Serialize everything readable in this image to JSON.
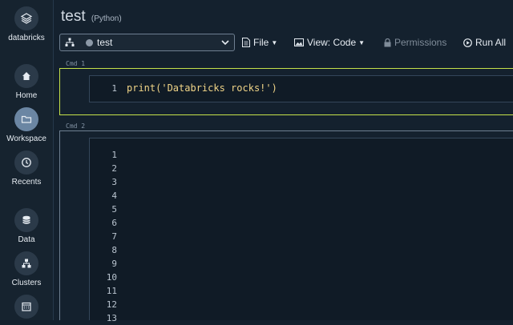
{
  "sidebar": {
    "logo_label": "databricks",
    "items": [
      {
        "label": "Home",
        "icon": "home-icon"
      },
      {
        "label": "Workspace",
        "icon": "folder-icon",
        "active": true
      },
      {
        "label": "Recents",
        "icon": "clock-icon"
      },
      {
        "label": "Data",
        "icon": "database-icon"
      },
      {
        "label": "Clusters",
        "icon": "cluster-icon"
      },
      {
        "label": "",
        "icon": "calendar-icon"
      }
    ]
  },
  "notebook": {
    "title": "test",
    "language": "(Python)"
  },
  "toolbar": {
    "cluster_name": "test",
    "file_label": "File",
    "view_label": "View: Code",
    "permissions_label": "Permissions",
    "run_all_label": "Run All"
  },
  "cells": [
    {
      "label": "Cmd 1",
      "lines": [
        "1"
      ],
      "code": "print('Databricks rocks!')"
    },
    {
      "label": "Cmd 2",
      "lines": [
        "1",
        "2",
        "3",
        "4",
        "5",
        "6",
        "7",
        "8",
        "9",
        "10",
        "11",
        "12",
        "13"
      ],
      "code": ""
    }
  ],
  "colors": {
    "background": "#14212e",
    "active_cell_border": "#c6e24a",
    "code_text": "#f0d487"
  }
}
